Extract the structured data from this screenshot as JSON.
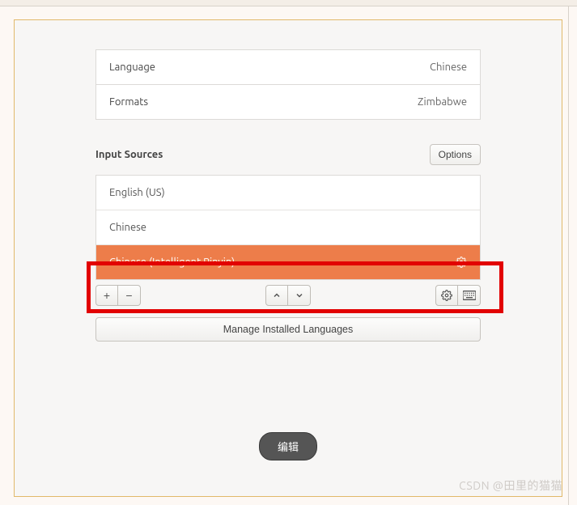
{
  "settings": {
    "language": {
      "label": "Language",
      "value": "Chinese"
    },
    "formats": {
      "label": "Formats",
      "value": "Zimbabwe"
    }
  },
  "inputSources": {
    "title": "Input Sources",
    "optionsLabel": "Options",
    "items": [
      {
        "label": "English (US)"
      },
      {
        "label": "Chinese"
      },
      {
        "label": "Chinese (Intelligent Pinyin)"
      }
    ],
    "manageLabel": "Manage Installed Languages"
  },
  "editButton": "编辑",
  "watermark": "CSDN @田里的猫猫"
}
